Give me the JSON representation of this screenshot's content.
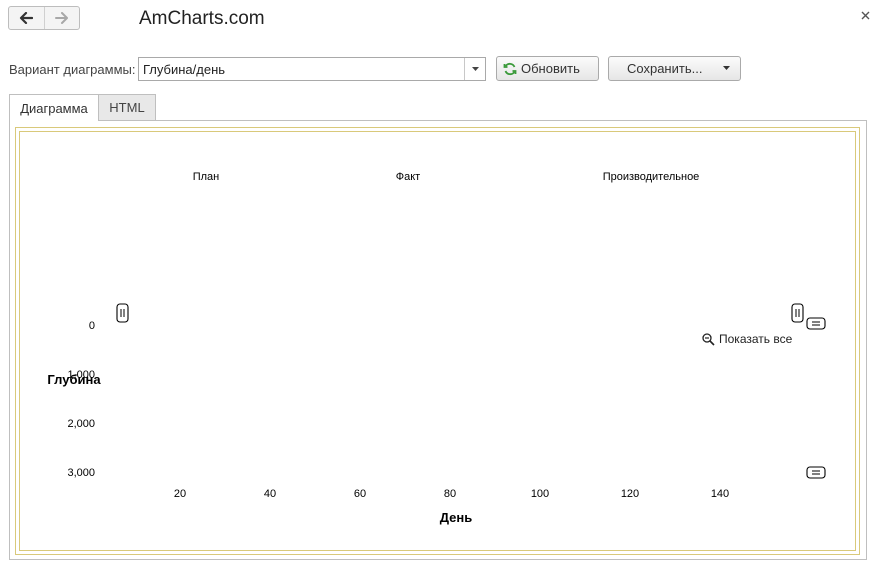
{
  "app": {
    "title": "AmCharts.com"
  },
  "toolbar": {
    "back_icon": "arrow-left-icon",
    "forward_icon": "arrow-right-icon",
    "close_icon": "close-icon"
  },
  "form": {
    "variant_label": "Вариант диаграммы:",
    "variant_value": "Глубина/день",
    "refresh_label": "Обновить",
    "save_label": "Сохранить..."
  },
  "tabs": [
    {
      "label": "Диаграмма",
      "active": true
    },
    {
      "label": "HTML",
      "active": false
    }
  ],
  "zoom": {
    "label": "Показать все"
  },
  "colors": {
    "accent": "#3a9a3a",
    "frame": "#d9c97a"
  },
  "chart_data": {
    "type": "line",
    "xlabel": "День",
    "ylabel": "Глубина",
    "legend": [
      "План",
      "Факт",
      "Производительное"
    ],
    "legend_position": "top",
    "x_ticks": [
      20,
      40,
      60,
      80,
      100,
      120,
      140
    ],
    "y_ticks": [
      0,
      1000,
      2000,
      3000
    ],
    "y_tick_labels": [
      "0",
      "1,000",
      "2,000",
      "3,000"
    ],
    "xlim": [
      0,
      160
    ],
    "ylim": [
      0,
      3000
    ],
    "y_reversed": true,
    "grid": false,
    "series": []
  }
}
